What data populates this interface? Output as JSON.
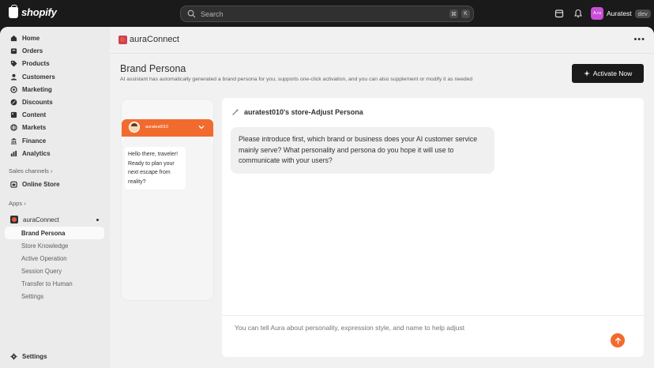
{
  "topbar": {
    "brand": "shopify",
    "search_placeholder": "Search",
    "shortcut_keys": [
      "⌘",
      "K"
    ],
    "store_initials": "A.ra",
    "store_name": "Auratest",
    "env_badge": "dev"
  },
  "sidebar": {
    "items": [
      {
        "label": "Home",
        "icon": "home-icon"
      },
      {
        "label": "Orders",
        "icon": "orders-icon"
      },
      {
        "label": "Products",
        "icon": "tag-icon"
      },
      {
        "label": "Customers",
        "icon": "person-icon"
      },
      {
        "label": "Marketing",
        "icon": "target-icon"
      },
      {
        "label": "Discounts",
        "icon": "discount-icon"
      },
      {
        "label": "Content",
        "icon": "content-icon"
      },
      {
        "label": "Markets",
        "icon": "globe-icon"
      },
      {
        "label": "Finance",
        "icon": "bank-icon"
      },
      {
        "label": "Analytics",
        "icon": "chart-icon"
      }
    ],
    "sales_channels_label": "Sales channels",
    "online_store": "Online Store",
    "apps_label": "Apps",
    "app_name": "auraConnect",
    "sub_items": [
      {
        "label": "Brand Persona",
        "active": true
      },
      {
        "label": "Store Knowledge"
      },
      {
        "label": "Active Operation"
      },
      {
        "label": "Session Query"
      },
      {
        "label": "Transfer to Human"
      },
      {
        "label": "Settings"
      }
    ],
    "settings": "Settings"
  },
  "app_header": {
    "title": "auraConnect",
    "more": "•••"
  },
  "page": {
    "title": "Brand Persona",
    "subtitle": "AI assistant has automatically generated a brand persona for you, supports one-click activation, and you can also supplement or modify it as needed",
    "activate_label": "Activate Now"
  },
  "phone_preview": {
    "bot_name": "auratest010",
    "greeting": "Hello there, traveler! Ready to plan your next escape from reality?"
  },
  "chat": {
    "title": "auratest010's store-Adjust Persona",
    "message": "Please introduce first, which brand or business does your AI customer service mainly serve? What personality and persona do you hope it will use to communicate with your users?",
    "input_placeholder": "You can tell Aura about personality, expression style, and name to help adjust"
  },
  "colors": {
    "accent": "#f26b2e",
    "primary_button": "#1a1a1a",
    "topbar": "#1a1a1a"
  }
}
